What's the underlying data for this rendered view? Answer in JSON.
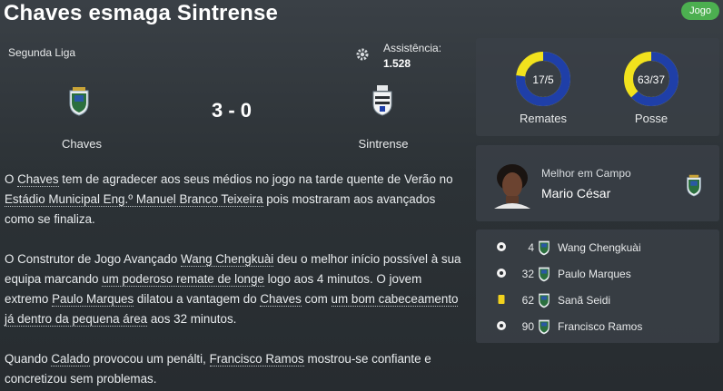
{
  "header": {
    "title": "Chaves esmaga Sintrense",
    "badge": "Jogo"
  },
  "match": {
    "league": "Segunda Liga",
    "attendance_label": "Assistência:",
    "attendance_value": "1.528",
    "score": "3 - 0",
    "home_team": "Chaves",
    "away_team": "Sintrense"
  },
  "stats": [
    {
      "value": "17/5",
      "label": "Remates",
      "share": 0.77
    },
    {
      "value": "63/37",
      "label": "Posse",
      "share": 0.63
    }
  ],
  "colors": {
    "home": "#1f3fa8",
    "away": "#f2e21d",
    "badge": "#4caf50"
  },
  "motm": {
    "label": "Melhor em Campo",
    "name": "Mario César"
  },
  "events": [
    {
      "icon": "ball-icon",
      "minute": "4",
      "player": "Wang Chengkuài"
    },
    {
      "icon": "ball-icon",
      "minute": "32",
      "player": "Paulo Marques"
    },
    {
      "icon": "yellow-card-icon",
      "minute": "62",
      "player": "Sanã Seidi"
    },
    {
      "icon": "ball-icon",
      "minute": "90",
      "player": "Francisco Ramos"
    }
  ],
  "report": {
    "p1": {
      "t1": "O ",
      "l1": "Chaves",
      "t2": " tem de agradecer aos seus médios no jogo na tarde quente de Verão no ",
      "l2": "Estádio Municipal Eng.º Manuel Branco Teixeira",
      "t3": " pois mostraram aos avançados como se finaliza."
    },
    "p2": {
      "t1": "O Construtor de Jogo Avançado ",
      "l1": "Wang Chengkuài",
      "t2": " deu o melhor início possível à sua equipa marcando ",
      "l2": "um poderoso remate de longe",
      "t3": " logo aos 4 minutos. O jovem extremo ",
      "l3": "Paulo Marques",
      "t4": " dilatou a vantagem do ",
      "l4": "Chaves",
      "t5": " com ",
      "l5": "um bom cabeceamento já dentro da pequena área",
      "t6": " aos 32 minutos."
    },
    "p3": {
      "t1": "Quando ",
      "l1": "Calado",
      "t2": " provocou um penálti, ",
      "l2": "Francisco Ramos",
      "t3": " mostrou-se confiante e concretizou sem problemas."
    }
  }
}
